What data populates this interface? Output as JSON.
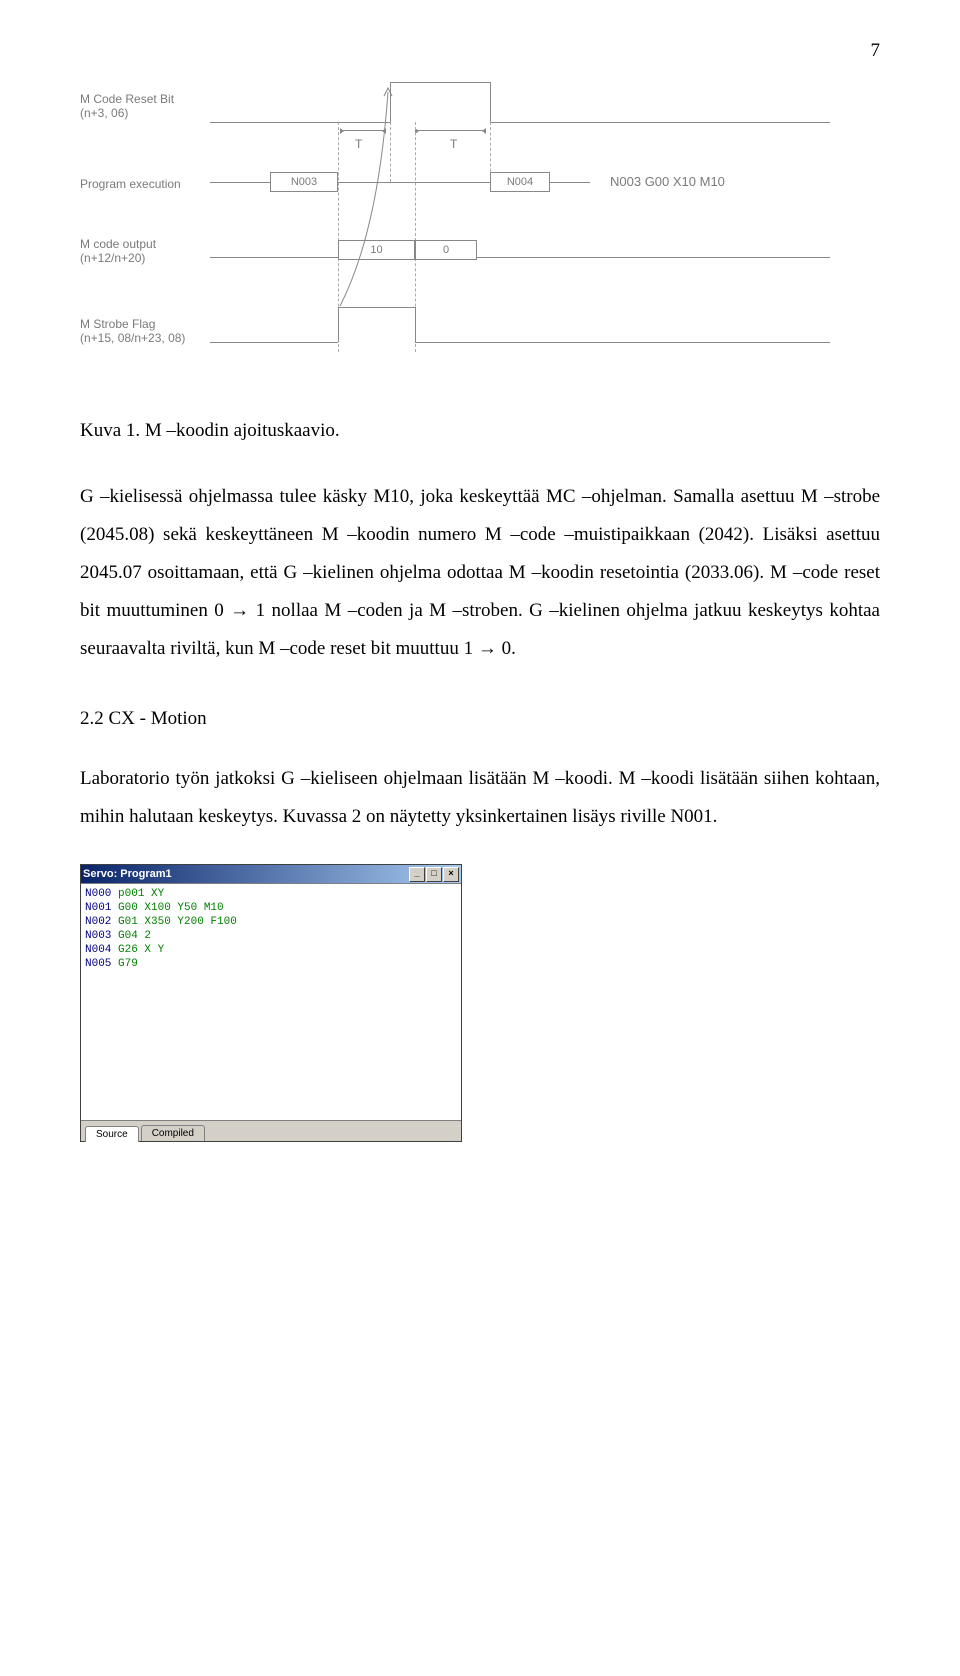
{
  "page_number": "7",
  "diagram": {
    "labels": {
      "reset_bit": "M Code Reset Bit",
      "reset_bit_sub": "(n+3, 06)",
      "program_exec": "Program execution",
      "m_code_output": "M code output",
      "m_code_output_sub": "(n+12/n+20)",
      "strobe_flag": "M Strobe Flag",
      "strobe_flag_sub": "(n+15, 08/n+23, 08)",
      "t1": "T",
      "t2": "T",
      "n003": "N003",
      "n004": "N004",
      "val10": "10",
      "val0": "0",
      "code_line": "N003 G00 X10 M10"
    }
  },
  "caption": "Kuva 1. M –koodin ajoituskaavio.",
  "para1": "G –kielisessä ohjelmassa tulee käsky M10, joka keskeyttää MC –ohjelman. Samalla asettuu M –strobe (2045.08) sekä keskeyttäneen M –koodin numero M –code –muistipaikkaan (2042). Lisäksi asettuu 2045.07 osoittamaan, että G –kielinen ohjelma odottaa M –koodin resetointia (2033.06). M –code reset bit muuttuminen 0 → 1 nollaa M –coden ja M –stroben. G –kielinen ohjelma jatkuu keskeytys kohtaa seuraavalta riviltä, kun M –code reset bit muuttuu 1 → 0.",
  "heading": "2.2 CX - Motion",
  "para2": "Laboratorio työn jatkoksi G –kieliseen ohjelmaan lisätään M –koodi. M –koodi lisätään siihen kohtaan, mihin halutaan keskeytys. Kuvassa 2 on näytetty yksinkertainen lisäys riville N001.",
  "servo": {
    "title": "Servo: Program1",
    "buttons": {
      "min": "_",
      "max": "□",
      "close": "×"
    },
    "lines": [
      {
        "num": "N000",
        "code": "p001 XY"
      },
      {
        "num": "N001",
        "code": "G00 X100 Y50 M10"
      },
      {
        "num": "N002",
        "code": "G01 X350 Y200 F100"
      },
      {
        "num": "N003",
        "code": "G04 2"
      },
      {
        "num": "N004",
        "code": "G26 X Y"
      },
      {
        "num": "N005",
        "code": "G79"
      }
    ],
    "tabs": {
      "source": "Source",
      "compiled": "Compiled"
    }
  }
}
